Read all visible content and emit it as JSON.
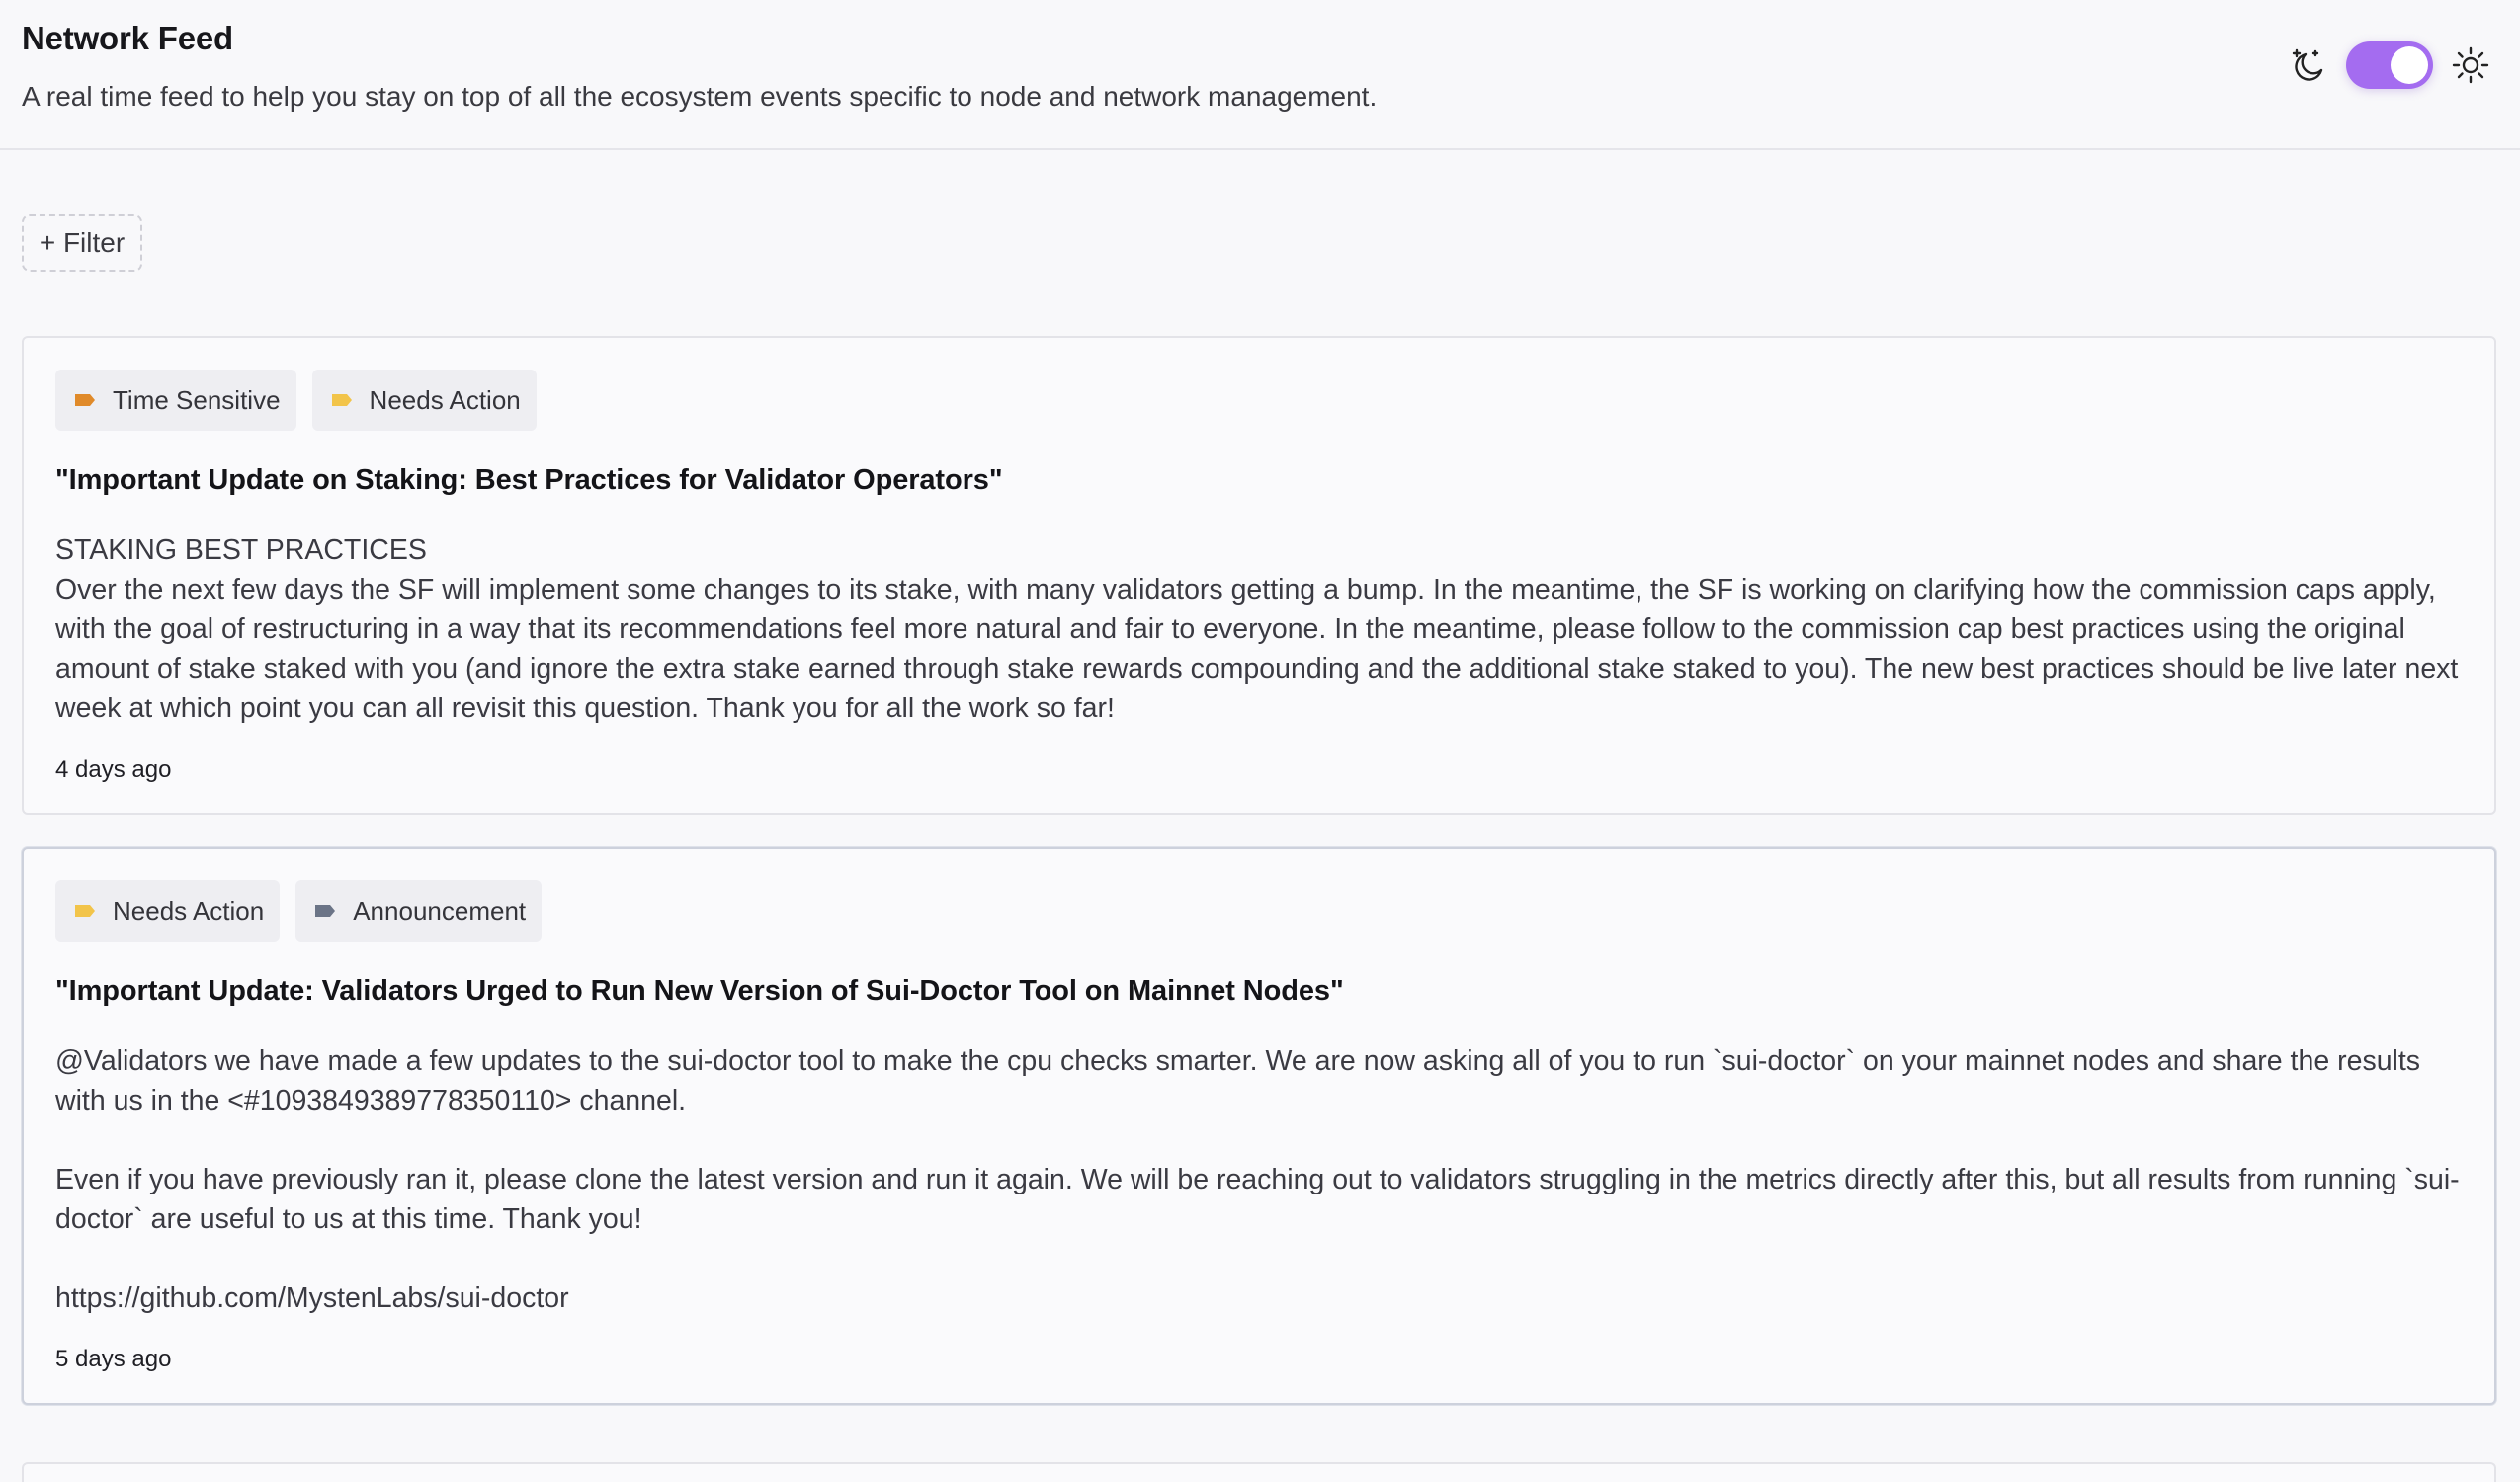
{
  "header": {
    "title": "Network Feed",
    "subtitle": "A real time feed to help you stay on top of all the ecosystem events specific to node and network management."
  },
  "theme": {
    "dark_icon": "moon-stars-icon",
    "light_icon": "sun-icon",
    "toggle_state": "on",
    "toggle_color": "#a46cf0"
  },
  "filter": {
    "label": "+ Filter"
  },
  "tag_colors": {
    "Time Sensitive": "#e08a2a",
    "Needs Action": "#f2c44a",
    "Announcement": "#6b7487"
  },
  "posts": [
    {
      "tags": [
        {
          "label": "Time Sensitive",
          "icon": "tag-icon",
          "color": "#e08a2a"
        },
        {
          "label": "Needs Action",
          "icon": "tag-icon",
          "color": "#f2c44a"
        }
      ],
      "title": "\"Important Update on Staking: Best Practices for Validator Operators\"",
      "body": "STAKING BEST PRACTICES\nOver the next few days the SF will implement some changes to its stake, with many validators getting a bump. In the meantime, the SF is working on clarifying how the commission caps apply, with the goal of restructuring in a way that its recommendations feel more natural and fair to everyone. In the meantime, please follow to the commission cap best practices using the original amount of stake staked with you (and ignore the extra stake earned through stake rewards compounding and the additional stake staked to you). The new best practices should be live later next week at which point you can all revisit this question. Thank you for all the work so far!",
      "time": "4 days ago"
    },
    {
      "tags": [
        {
          "label": "Needs Action",
          "icon": "tag-icon",
          "color": "#f2c44a"
        },
        {
          "label": "Announcement",
          "icon": "tag-icon",
          "color": "#6b7487"
        }
      ],
      "title": "\"Important Update: Validators Urged to Run New Version of Sui-Doctor Tool on Mainnet Nodes\"",
      "body": "@Validators we have made a few updates to the sui-doctor tool to make the cpu checks smarter. We are now asking all of you to run `sui-doctor` on your mainnet nodes and share the results with us in the <#1093849389778350110> channel.\n\nEven if you have previously ran it, please clone the latest version and run it again. We will be reaching out to validators struggling in the metrics directly after this, but all results from running `sui-doctor` are useful to us at this time. Thank you!\n\nhttps://github.com/MystenLabs/sui-doctor",
      "time": "5 days ago"
    }
  ]
}
